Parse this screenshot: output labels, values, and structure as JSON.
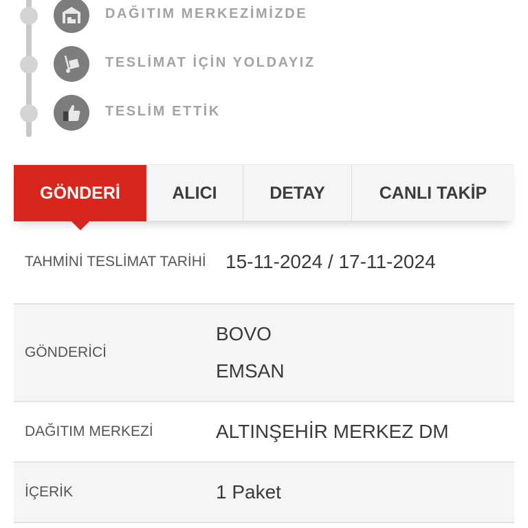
{
  "timeline": {
    "steps": [
      {
        "label": "DAĞITIM MERKEZİMİZDE",
        "icon": "warehouse-icon"
      },
      {
        "label": "TESLİMAT İÇİN YOLDAYIZ",
        "icon": "hand-truck-icon"
      },
      {
        "label": "TESLİM ETTİK",
        "icon": "thumbs-up-icon"
      }
    ]
  },
  "tabs": [
    {
      "label": "GÖNDERİ",
      "active": true
    },
    {
      "label": "ALICI",
      "active": false
    },
    {
      "label": "DETAY",
      "active": false
    },
    {
      "label": "CANLI TAKİP",
      "active": false
    }
  ],
  "colors": {
    "accent": "#d9261c",
    "icon_bg": "#7d7d7d",
    "muted_text": "#a3a3a3"
  },
  "info": {
    "delivery": {
      "label": "TAHMİNİ TESLİMAT TARİHİ",
      "value": "15-11-2024 / 17-11-2024"
    },
    "sender": {
      "label": "GÖNDERİCİ",
      "lines": [
        "BOVO",
        "EMSAN"
      ]
    },
    "center": {
      "label": "DAĞITIM MERKEZİ",
      "value": "ALTINŞEHİR MERKEZ DM"
    },
    "content": {
      "label": "İÇERİK",
      "value": "1 Paket"
    }
  }
}
